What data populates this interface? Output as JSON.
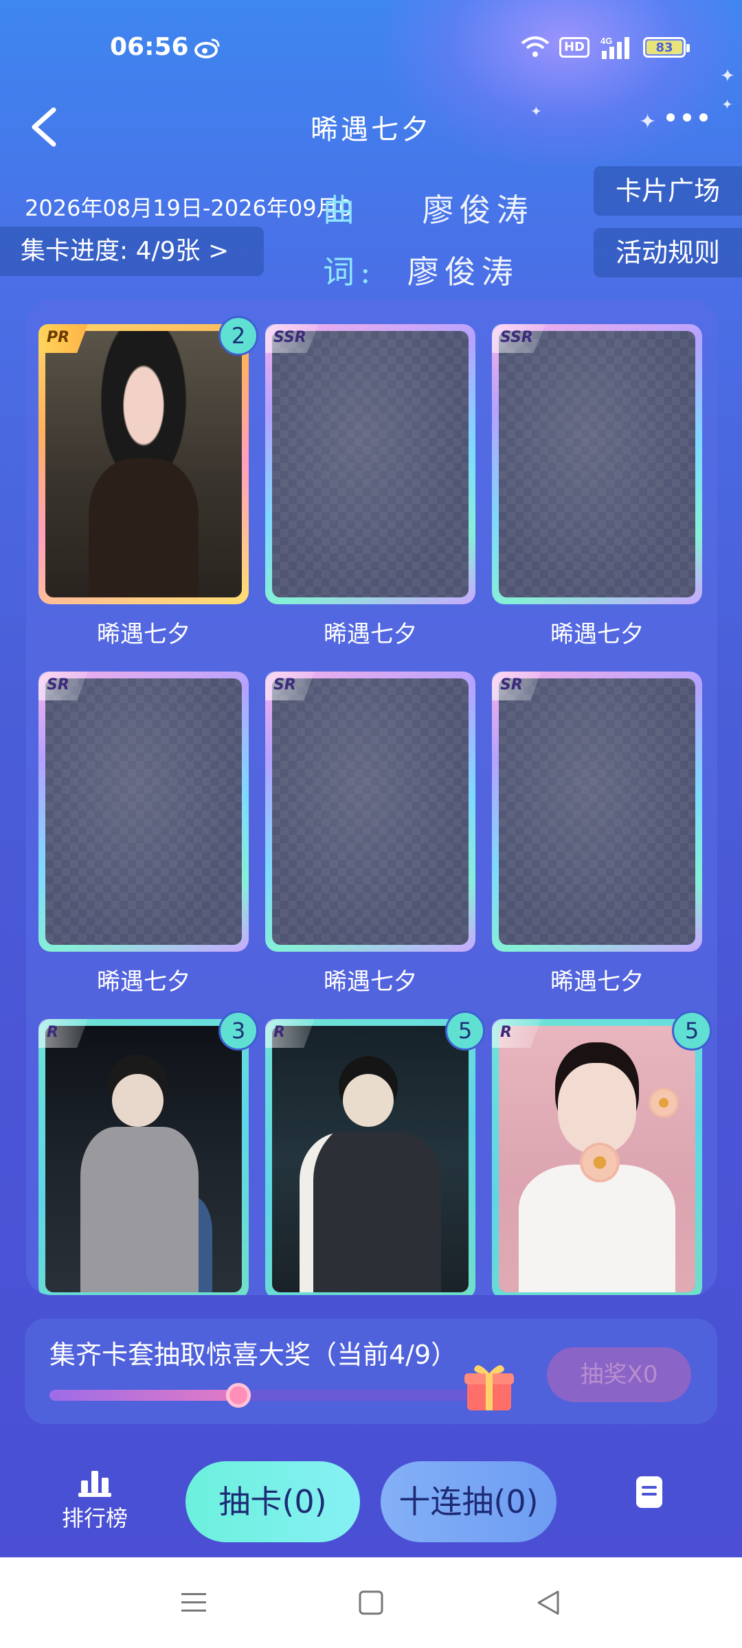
{
  "status_bar": {
    "time": "06:56",
    "icons": [
      "weibo-icon",
      "wifi-icon",
      "hd-icon",
      "signal-4g-icon",
      "battery-icon"
    ],
    "hd": "HD",
    "network": "4G",
    "battery": "83"
  },
  "header": {
    "title": "晞遇七夕",
    "back_icon": "chevron-left-icon",
    "more_icon": "more-dots-icon"
  },
  "event": {
    "date_range": "2026年08月19日-2026年09月0",
    "lyric_composer": {
      "label": "曲",
      "name": "廖俊涛"
    },
    "lyric_lyricist": {
      "label": "词:",
      "name": "廖俊涛"
    },
    "progress_label": "集卡进度: 4/9张 >",
    "card_plaza": "卡片广场",
    "rules": "活动规则"
  },
  "cards": [
    {
      "rarity": "PR",
      "label": "晞遇七夕",
      "count": "2",
      "collected": true
    },
    {
      "rarity": "SSR",
      "label": "晞遇七夕",
      "count": "",
      "collected": false
    },
    {
      "rarity": "SSR",
      "label": "晞遇七夕",
      "count": "",
      "collected": false
    },
    {
      "rarity": "SR",
      "label": "晞遇七夕",
      "count": "",
      "collected": false
    },
    {
      "rarity": "SR",
      "label": "晞遇七夕",
      "count": "",
      "collected": false
    },
    {
      "rarity": "SR",
      "label": "晞遇七夕",
      "count": "",
      "collected": false
    },
    {
      "rarity": "R",
      "label": "",
      "count": "3",
      "collected": true
    },
    {
      "rarity": "R",
      "label": "",
      "count": "5",
      "collected": true
    },
    {
      "rarity": "R",
      "label": "",
      "count": "5",
      "collected": true
    }
  ],
  "prize": {
    "title": "集齐卡套抽取惊喜大奖（当前4/9）",
    "progress_fraction": 0.444,
    "draw_label": "抽奖X0",
    "gift_icon": "gift-icon"
  },
  "actions": {
    "rank_label": "排行榜",
    "rank_icon": "bar-chart-icon",
    "draw_label": "抽卡(0)",
    "draw10_label": "十连抽(0)",
    "record_icon": "record-list-icon"
  },
  "system_nav": [
    "menu-icon",
    "home-square-icon",
    "back-triangle-icon"
  ],
  "colors": {
    "accent_teal": "#6cf0dc",
    "background_blue": "#4a5ed8",
    "badge": "#5fe0d2"
  }
}
